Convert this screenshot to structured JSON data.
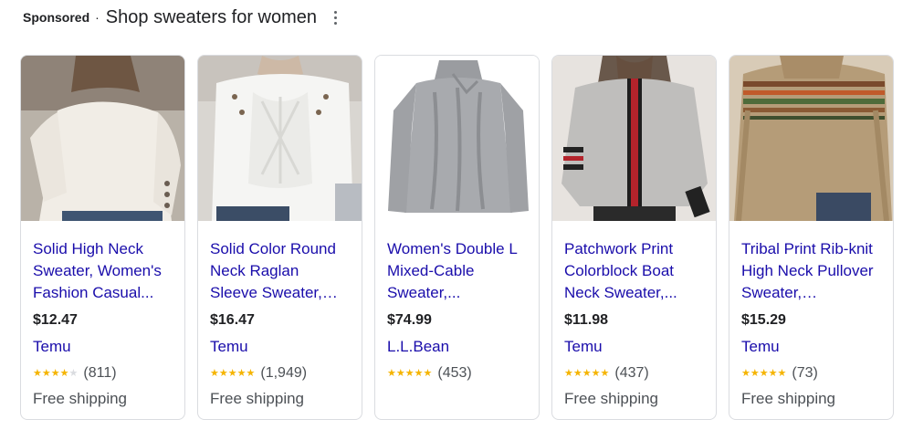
{
  "header": {
    "sponsored": "Sponsored",
    "separator": "·",
    "title": "Shop sweaters for women",
    "more_icon": "more-vertical-icon"
  },
  "products": [
    {
      "name": "Solid High Neck Sweater, Women's Fashion Casual...",
      "price": "$12.47",
      "seller": "Temu",
      "rating": 4,
      "reviews": "(811)",
      "shipping": "Free shipping"
    },
    {
      "name": "Solid Color Round Neck Raglan Sleeve Sweater, Women's...",
      "price": "$16.47",
      "seller": "Temu",
      "rating": 4.5,
      "reviews": "(1,949)",
      "shipping": "Free shipping"
    },
    {
      "name": "Women's Double L Mixed-Cable Sweater,...",
      "price": "$74.99",
      "seller": "L.L.Bean",
      "rating": 4.5,
      "reviews": "(453)",
      "shipping": ""
    },
    {
      "name": "Patchwork Print Colorblock Boat Neck Sweater,...",
      "price": "$11.98",
      "seller": "Temu",
      "rating": 4.5,
      "reviews": "(437)",
      "shipping": "Free shipping"
    },
    {
      "name": "Tribal Print Rib-knit High Neck Pullover Sweater, Women's...",
      "price": "$15.29",
      "seller": "Temu",
      "rating": 4.5,
      "reviews": "(73)",
      "shipping": "Free shipping"
    }
  ],
  "colors": {
    "link": "#1a0dab",
    "star": "#f5b400",
    "border": "#dadce0"
  }
}
